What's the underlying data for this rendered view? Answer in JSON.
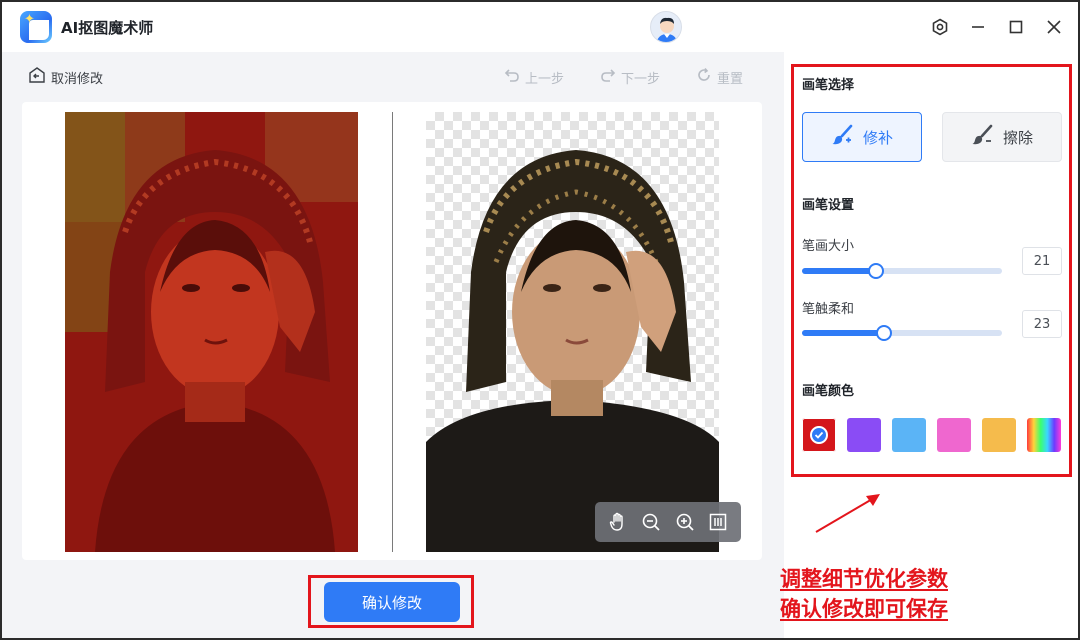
{
  "app": {
    "title": "AI抠图魔术师"
  },
  "window_controls": [
    "settings-icon",
    "minimize-icon",
    "maximize-icon",
    "close-icon"
  ],
  "toolbar": {
    "cancel_label": "取消修改",
    "undo_label": "上一步",
    "redo_label": "下一步",
    "reset_label": "重置"
  },
  "canvas": {
    "zoom_tools": [
      "hand-icon",
      "zoom-out-icon",
      "zoom-in-icon",
      "fit-screen-icon"
    ]
  },
  "confirm_label": "确认修改",
  "panel": {
    "brush_select_title": "画笔选择",
    "brush_options": [
      {
        "label": "修补",
        "icon": "brush-plus-icon",
        "selected": true
      },
      {
        "label": "擦除",
        "icon": "brush-minus-icon",
        "selected": false
      }
    ],
    "brush_settings_title": "画笔设置",
    "size_label": "笔画大小",
    "size_value": "21",
    "size_level": 0.37,
    "softness_label": "笔触柔和",
    "softness_value": "23",
    "softness_level": 0.41,
    "color_title": "画笔颜色",
    "colors": [
      "#d4161b",
      "#8a4cf5",
      "#5bb4f6",
      "#ef67cf",
      "#f5bb4c",
      "rainbow"
    ],
    "selected_color": "#d4161b"
  },
  "annotation": {
    "line1": "调整细节优化参数",
    "line2": "确认修改即可保存",
    "color": "#e3151c"
  },
  "accent": "#2f7bf6"
}
